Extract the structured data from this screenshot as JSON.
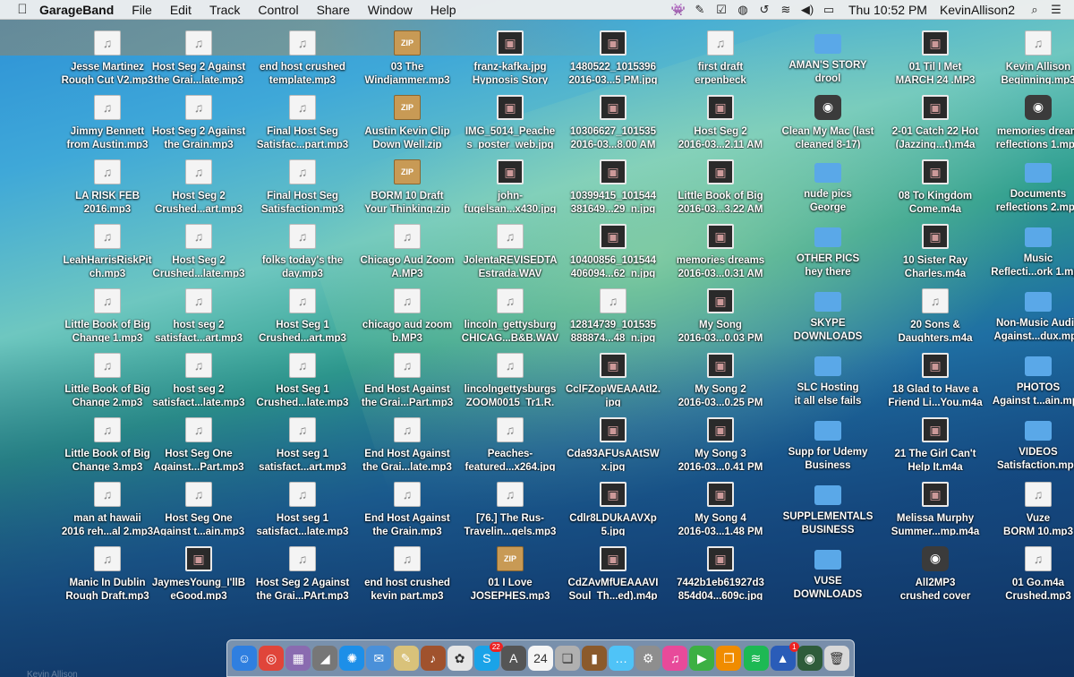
{
  "menubar": {
    "app_name": "GarageBand",
    "items": [
      "File",
      "Edit",
      "Track",
      "Control",
      "Share",
      "Window",
      "Help"
    ],
    "clock": "Thu 10:52 PM",
    "user": "KevinAllison2",
    "status_icons": [
      "alien-icon",
      "pen-icon",
      "checklist-icon",
      "circle-dash-icon",
      "time-machine-icon",
      "wifi-icon",
      "volume-icon",
      "battery-icon"
    ]
  },
  "desktop": {
    "columns": [
      [
        {
          "label": "Jesse Martinez\nRough Cut V2.mp3",
          "icon": "doc"
        },
        {
          "label": "Jimmy Bennett\nfrom Austin.mp3",
          "icon": "doc"
        },
        {
          "label": "LA RISK FEB\n2016.mp3",
          "icon": "doc"
        },
        {
          "label": "LeahHarrisRiskPit\nch.mp3",
          "icon": "doc"
        },
        {
          "label": "Little Book of Big\nChange 1.mp3",
          "icon": "doc"
        },
        {
          "label": "Little Book of Big\nChange 2.mp3",
          "icon": "doc"
        },
        {
          "label": "Little Book of Big\nChange 3.mp3",
          "icon": "doc"
        },
        {
          "label": "man at hawaii\n2016 reh...al 2.mp3",
          "icon": "doc"
        },
        {
          "label": "Manic In Dublin\nRough Draft.mp3",
          "icon": "doc"
        }
      ],
      [
        {
          "label": "Host Seg 2 Against\nthe Grai...late.mp3",
          "icon": "doc"
        },
        {
          "label": "Host Seg 2 Against\nthe Grain.mp3",
          "icon": "doc"
        },
        {
          "label": "Host Seg 2\nCrushed...art.mp3",
          "icon": "doc"
        },
        {
          "label": "Host Seg 2\nCrushed...late.mp3",
          "icon": "doc"
        },
        {
          "label": "host seg 2\nsatisfact...art.mp3",
          "icon": "doc"
        },
        {
          "label": "host seg 2\nsatisfact...late.mp3",
          "icon": "doc"
        },
        {
          "label": "Host Seg One\nAgainst...Part.mp3",
          "icon": "doc"
        },
        {
          "label": "Host Seg One\nAgainst t...ain.mp3",
          "icon": "doc"
        },
        {
          "label": "JaymesYoung_I'llB\neGood.mp3",
          "icon": "img"
        }
      ],
      [
        {
          "label": "end host crushed\ntemplate.mp3",
          "icon": "doc"
        },
        {
          "label": "Final Host Seg\nSatisfac...part.mp3",
          "icon": "doc"
        },
        {
          "label": "Final Host Seg\nSatisfaction.mp3",
          "icon": "doc"
        },
        {
          "label": "folks today's the\nday.mp3",
          "icon": "doc"
        },
        {
          "label": "Host Seg 1\nCrushed...art.mp3",
          "icon": "doc"
        },
        {
          "label": "Host Seg 1\nCrushed...late.mp3",
          "icon": "doc"
        },
        {
          "label": "Host seg 1\nsatisfact...art.mp3",
          "icon": "doc"
        },
        {
          "label": "Host seg 1\nsatisfact...late.mp3",
          "icon": "doc"
        },
        {
          "label": "Host Seg 2 Against\nthe Grai...PArt.mp3",
          "icon": "doc"
        }
      ],
      [
        {
          "label": "03 The\nWindjammer.mp3",
          "icon": "zip"
        },
        {
          "label": "Austin Kevin Clip\nDown Well.zip",
          "icon": "zip"
        },
        {
          "label": "BORM 10 Draft\nYour Thinking.zip",
          "icon": "zip"
        },
        {
          "label": "Chicago Aud Zoom\nA.MP3",
          "icon": "doc"
        },
        {
          "label": "chicago aud zoom\nb.MP3",
          "icon": "doc"
        },
        {
          "label": "End Host Against\nthe Grai...Part.mp3",
          "icon": "doc"
        },
        {
          "label": "End Host Against\nthe Grai...late.mp3",
          "icon": "doc"
        },
        {
          "label": "End Host Against\nthe Grain.mp3",
          "icon": "doc"
        },
        {
          "label": "end host crushed\nkevin part.mp3",
          "icon": "doc"
        }
      ],
      [
        {
          "label": "franz-kafka.jpg\nHypnosis Story",
          "icon": "img"
        },
        {
          "label": "IMG_5014_Peache\ns_poster_web.jpg",
          "icon": "img"
        },
        {
          "label": "john-\nfugelsan...x430.jpg",
          "icon": "img"
        },
        {
          "label": "JolentaREVISEDTA\nEstrada.WAV",
          "icon": "doc"
        },
        {
          "label": "lincoln_gettysburg\nCHICAG...B&B.WAV",
          "icon": "doc"
        },
        {
          "label": "lincolngettysburgs\nZOOM0015_Tr1.R.",
          "icon": "doc"
        },
        {
          "label": "Peaches-\nfeatured...x264.jpg",
          "icon": "doc"
        },
        {
          "label": "[76.] The Rus-\nTravelin...gels.mp3",
          "icon": "doc"
        },
        {
          "label": "01 I Love\nJOSEPHES.mp3",
          "icon": "zip"
        }
      ],
      [
        {
          "label": "1480522_1015396\n2016-03...5 PM.jpg",
          "icon": "img"
        },
        {
          "label": "10306627_101535\n2016-03...8.00 AM",
          "icon": "img"
        },
        {
          "label": "10399415_101544\n381649...29_n.jpg",
          "icon": "img"
        },
        {
          "label": "10400856_101544\n406094...62_n.jpg",
          "icon": "img"
        },
        {
          "label": "12814739_101535\n888874...48_n.jpg",
          "icon": "doc"
        },
        {
          "label": "CclFZopWEAAAtl2.\njpg",
          "icon": "img"
        },
        {
          "label": "Cda93AFUsAAtSW\nx.jpg",
          "icon": "img"
        },
        {
          "label": "Cdlr8LDUkAAVXp\n5.jpg",
          "icon": "img"
        },
        {
          "label": "CdZAvMfUEAAAVI\nSoul_Th...ed).m4p",
          "icon": "img"
        }
      ],
      [
        {
          "label": "first draft\nerpenbeck",
          "icon": "doc"
        },
        {
          "label": "Host Seg 2\n2016-03...2.11 AM",
          "icon": "img"
        },
        {
          "label": "Little Book of Big\n2016-03...3.22 AM",
          "icon": "img"
        },
        {
          "label": "memories dreams\n2016-03...0.31 AM",
          "icon": "img"
        },
        {
          "label": "My Song\n2016-03...0.03 PM",
          "icon": "img"
        },
        {
          "label": "My Song 2\n2016-03...0.25 PM",
          "icon": "img"
        },
        {
          "label": "My Song 3\n2016-03...0.41 PM",
          "icon": "img"
        },
        {
          "label": "My Song 4\n2016-03...1.48 PM",
          "icon": "img"
        },
        {
          "label": "7442b1eb61927d3\n854d04...609c.jpg",
          "icon": "img"
        }
      ],
      [
        {
          "label": "AMAN'S STORY\ndrool",
          "icon": "folder"
        },
        {
          "label": "Clean My Mac (last\ncleaned 8-17)",
          "icon": "app"
        },
        {
          "label": "nude pics\nGeorge",
          "icon": "folder"
        },
        {
          "label": "OTHER PICS\nhey there",
          "icon": "folder"
        },
        {
          "label": "SKYPE\nDOWNLOADS",
          "icon": "folder"
        },
        {
          "label": "SLC Hosting\nit all else fails",
          "icon": "folder"
        },
        {
          "label": "Supp for Udemy\nBusiness",
          "icon": "folder"
        },
        {
          "label": "SUPPLEMENTALS\nBUSINESS",
          "icon": "folder"
        },
        {
          "label": "VUSE\nDOWNLOADS",
          "icon": "folder"
        }
      ],
      [
        {
          "label": "01 Til I Met\nMARCH 24 .MP3",
          "icon": "img"
        },
        {
          "label": "2-01 Catch 22 Hot\n(Jazzing...t).m4a",
          "icon": "img"
        },
        {
          "label": "08 To Kingdom\nCome.m4a",
          "icon": "img"
        },
        {
          "label": "10 Sister Ray\nCharles.m4a",
          "icon": "img"
        },
        {
          "label": "20 Sons &\nDaughters.m4a",
          "icon": "doc"
        },
        {
          "label": "18 Glad to Have a\nFriend Li...You.m4a",
          "icon": "img"
        },
        {
          "label": "21 The Girl Can't\nHelp It.m4a",
          "icon": "img"
        },
        {
          "label": "Melissa Murphy\nSummer...mp.m4a",
          "icon": "img"
        },
        {
          "label": "All2MP3\ncrushed cover",
          "icon": "app"
        }
      ],
      [
        {
          "label": "Kevin Allison\nBeginning.mp3",
          "icon": "doc"
        },
        {
          "label": "memories dream\nreflections 1.mp3",
          "icon": "app"
        },
        {
          "label": "Documents\nreflections 2.mp3",
          "icon": "folder"
        },
        {
          "label": "Music\nReflecti...ork 1.mp3",
          "icon": "folder"
        },
        {
          "label": "Non-Music Audio\nAgainst...dux.mp3",
          "icon": "folder"
        },
        {
          "label": "PHOTOS\nAgainst t...ain.mp3",
          "icon": "folder"
        },
        {
          "label": "VIDEOS\nSatisfaction.mp3",
          "icon": "folder"
        },
        {
          "label": "Vuze\nBORM 10.mp3",
          "icon": "doc"
        },
        {
          "label": "01 Go.m4a\nCrushed.mp3",
          "icon": "doc"
        }
      ]
    ]
  },
  "dock": {
    "apps": [
      {
        "name": "finder-icon",
        "glyph": "☺",
        "color": "#2f7fe0"
      },
      {
        "name": "chrome-icon",
        "glyph": "◎",
        "color": "#e0453a"
      },
      {
        "name": "archive-icon",
        "glyph": "▦",
        "color": "#8a6bb0"
      },
      {
        "name": "speaker-icon",
        "glyph": "◢",
        "color": "#777"
      },
      {
        "name": "safari-icon",
        "glyph": "✺",
        "color": "#1d8fe8"
      },
      {
        "name": "mail-icon",
        "glyph": "✉",
        "color": "#4a90d9"
      },
      {
        "name": "notes-icon",
        "glyph": "✎",
        "color": "#d9c27a"
      },
      {
        "name": "guitar-icon",
        "glyph": "♪",
        "color": "#a0522d"
      },
      {
        "name": "photos-icon",
        "glyph": "✿",
        "color": "#e6e6e6"
      },
      {
        "name": "skype-icon",
        "glyph": "S",
        "color": "#1aa3e8",
        "badge": "22"
      },
      {
        "name": "app-store-icon",
        "glyph": "A",
        "color": "#555"
      },
      {
        "name": "calendar-icon",
        "glyph": "24",
        "color": "#f5f5f5"
      },
      {
        "name": "preview-icon",
        "glyph": "❏",
        "color": "#b0b0b0"
      },
      {
        "name": "books-icon",
        "glyph": "▮",
        "color": "#8b5a2b"
      },
      {
        "name": "messages-icon",
        "glyph": "…",
        "color": "#4fc3f7"
      },
      {
        "name": "settings-icon",
        "glyph": "⚙",
        "color": "#8e8e8e"
      },
      {
        "name": "itunes-icon",
        "glyph": "♫",
        "color": "#e84a9a"
      },
      {
        "name": "facetime-icon",
        "glyph": "▶",
        "color": "#3cb043"
      },
      {
        "name": "ibooks-icon",
        "glyph": "❐",
        "color": "#f08c00"
      },
      {
        "name": "spotify-icon",
        "glyph": "≋",
        "color": "#1db954"
      },
      {
        "name": "vuze-icon",
        "glyph": "▲",
        "color": "#2a5cb8",
        "badge": "1"
      },
      {
        "name": "alien-app-icon",
        "glyph": "◉",
        "color": "#2e5c3a"
      },
      {
        "name": "trash-icon",
        "glyph": "🗑",
        "color": "#d8d8d8"
      }
    ]
  },
  "footer": {
    "ghost_text": "Kevin Allison"
  }
}
